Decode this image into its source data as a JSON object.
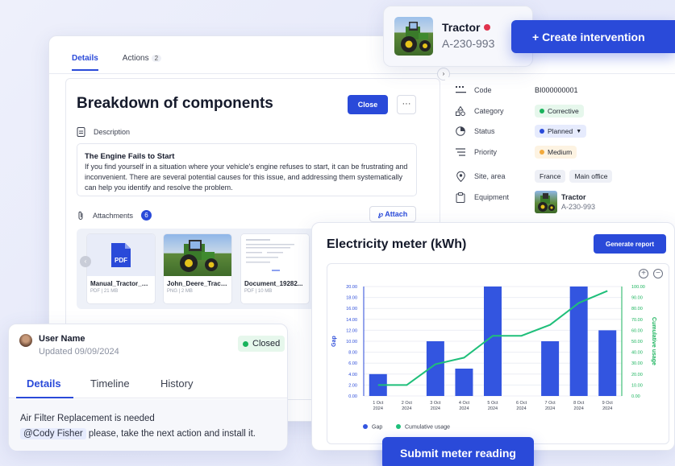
{
  "tabs": [
    {
      "label": "Details"
    },
    {
      "label": "Actions",
      "count": "2"
    }
  ],
  "breakdown": {
    "title": "Breakdown of components",
    "close_label": "Close",
    "more_label": "···",
    "description_label": "Description",
    "description_title": "The Engine Fails to Start",
    "description_text": "If you find yourself in a situation where your vehicle's engine refuses to start, it can be frustrating and inconvenient. There are several potential causes for this issue, and addressing them systematically can help you identify and resolve the problem.",
    "attachments_label": "Attachments",
    "attachments_count": "6",
    "attach_label": "Attach"
  },
  "files": [
    {
      "name": "Manual_Tractor_C...",
      "type": "PDF",
      "size": "21 MB"
    },
    {
      "name": "John_Deere_Tract...",
      "type": "PNG",
      "size": "2 MB"
    },
    {
      "name": "Document_19282...",
      "type": "PDF",
      "size": "10 MB"
    }
  ],
  "details": {
    "code_label": "Code",
    "code_value": "BI000000001",
    "category_label": "Category",
    "category_value": "Corrective",
    "status_label": "Status",
    "status_value": "Planned",
    "priority_label": "Priority",
    "priority_value": "Medium",
    "site_label": "Site, area",
    "site_country": "France",
    "site_area": "Main office",
    "equipment_label": "Equipment",
    "equipment_name": "Tractor",
    "equipment_code": "A-230-993"
  },
  "tractor_popover": {
    "name": "Tractor",
    "code": "A-230-993"
  },
  "create_intervention_label": "+ Create intervention",
  "electricity": {
    "title": "Electricity meter (kWh)",
    "report_label": "Generate report",
    "submit_label": "Submit meter reading"
  },
  "chart_data": {
    "type": "bar",
    "categories": [
      "1 Oct\n2024",
      "2 Oct\n2024",
      "3 Oct\n2024",
      "4 Oct\n2024",
      "5 Oct\n2024",
      "6 Oct\n2024",
      "7 Oct\n2024",
      "8 Oct\n2024",
      "9 Oct\n2024"
    ],
    "series": [
      {
        "name": "Gap",
        "type": "bar",
        "axis": "left",
        "color": "#3355e0",
        "values": [
          4,
          0,
          10,
          5,
          20,
          0,
          10,
          20,
          12
        ]
      },
      {
        "name": "Cumulative usage",
        "type": "line",
        "axis": "right",
        "color": "#1fbf7a",
        "values": [
          10,
          10,
          29,
          35,
          55,
          55,
          65,
          85,
          96
        ]
      }
    ],
    "ylabel": "Gap",
    "y2label": "Cumulative usage",
    "ylim": [
      0,
      20
    ],
    "y2lim": [
      0,
      100
    ],
    "yticks": [
      "0.00",
      "2.00",
      "4.00",
      "6.00",
      "8.00",
      "10.00",
      "12.00",
      "14.00",
      "16.00",
      "18.00",
      "20.00"
    ],
    "y2ticks": [
      "0.00",
      "10.00",
      "20.00",
      "30.00",
      "40.00",
      "50.00",
      "60.00",
      "70.00",
      "80.00",
      "90.00",
      "100.00"
    ],
    "legend_position": "bottom-left"
  },
  "user_card": {
    "name": "User Name",
    "updated": "Updated 09/09/2024",
    "status": "Closed",
    "tabs": [
      "Details",
      "Timeline",
      "History"
    ],
    "message_line1": "Air Filter Replacement is needed",
    "mention": "@Cody Fisher",
    "message_line2": " please, take the next action and install it."
  },
  "colors": {
    "accent": "#2a4ad9",
    "success": "#19b35c",
    "danger": "#e0334d"
  }
}
